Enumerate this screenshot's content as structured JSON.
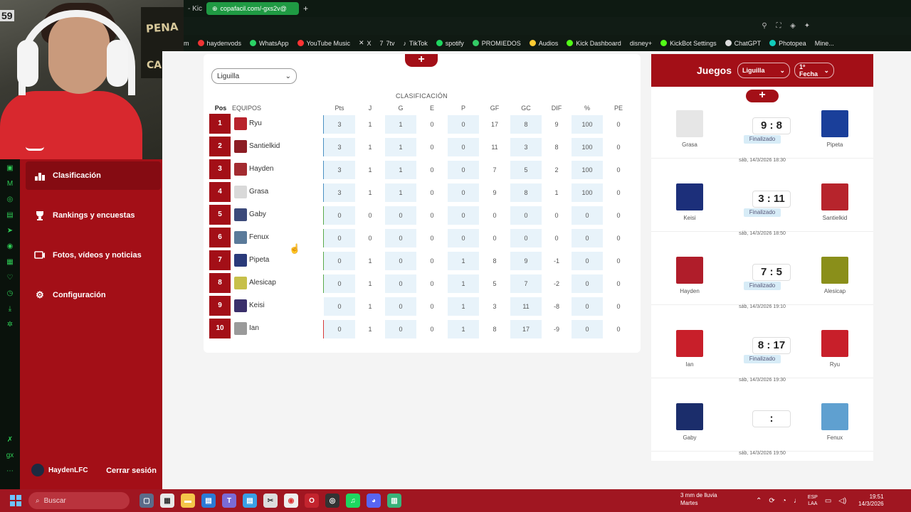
{
  "browser": {
    "prev_tab": "- Kic",
    "active_tab": "copafacil.com/-gxs2v@",
    "bookmarks": [
      "m",
      "haydenvods",
      "WhatsApp",
      "YouTube Music",
      "X",
      "7tv",
      "TikTok",
      "spotify",
      "PROMIEDOS",
      "Audios",
      "Kick Dashboard",
      "disney+",
      "KickBot Settings",
      "ChatGPT",
      "Photopea",
      "Mine..."
    ]
  },
  "webcam": {
    "wall_text_1": "PENA",
    "wall_text_2": "CAMPE",
    "number": "59"
  },
  "sidebar": {
    "items": [
      {
        "label": "Clasificación"
      },
      {
        "label": "Rankings y encuestas"
      },
      {
        "label": "Fotos, vídeos y noticias"
      },
      {
        "label": "Configuración"
      }
    ],
    "user": "HaydenLFC",
    "logout": "Cerrar sesión"
  },
  "standings": {
    "add_label": "+",
    "group_select": "Liguilla",
    "title": "CLASIFICACIÓN",
    "headers": {
      "pos": "Pos",
      "team": "EQUIPOS",
      "pts": "Pts",
      "j": "J",
      "g": "G",
      "e": "E",
      "p": "P",
      "gf": "GF",
      "gc": "GC",
      "dif": "DIF",
      "pct": "%",
      "pe": "PE"
    },
    "rows": [
      {
        "pos": "1",
        "team": "Ryu",
        "pts": "3",
        "j": "1",
        "g": "1",
        "e": "0",
        "p": "0",
        "gf": "17",
        "gc": "8",
        "dif": "9",
        "pct": "100",
        "pe": "0"
      },
      {
        "pos": "2",
        "team": "Santielkid",
        "pts": "3",
        "j": "1",
        "g": "1",
        "e": "0",
        "p": "0",
        "gf": "11",
        "gc": "3",
        "dif": "8",
        "pct": "100",
        "pe": "0"
      },
      {
        "pos": "3",
        "team": "Hayden",
        "pts": "3",
        "j": "1",
        "g": "1",
        "e": "0",
        "p": "0",
        "gf": "7",
        "gc": "5",
        "dif": "2",
        "pct": "100",
        "pe": "0"
      },
      {
        "pos": "4",
        "team": "Grasa",
        "pts": "3",
        "j": "1",
        "g": "1",
        "e": "0",
        "p": "0",
        "gf": "9",
        "gc": "8",
        "dif": "1",
        "pct": "100",
        "pe": "0"
      },
      {
        "pos": "5",
        "team": "Gaby",
        "pts": "0",
        "j": "0",
        "g": "0",
        "e": "0",
        "p": "0",
        "gf": "0",
        "gc": "0",
        "dif": "0",
        "pct": "0",
        "pe": "0"
      },
      {
        "pos": "6",
        "team": "Fenux",
        "pts": "0",
        "j": "0",
        "g": "0",
        "e": "0",
        "p": "0",
        "gf": "0",
        "gc": "0",
        "dif": "0",
        "pct": "0",
        "pe": "0"
      },
      {
        "pos": "7",
        "team": "Pipeta",
        "pts": "0",
        "j": "1",
        "g": "0",
        "e": "0",
        "p": "1",
        "gf": "8",
        "gc": "9",
        "dif": "-1",
        "pct": "0",
        "pe": "0"
      },
      {
        "pos": "8",
        "team": "Alesicap",
        "pts": "0",
        "j": "1",
        "g": "0",
        "e": "0",
        "p": "1",
        "gf": "5",
        "gc": "7",
        "dif": "-2",
        "pct": "0",
        "pe": "0"
      },
      {
        "pos": "9",
        "team": "Keisi",
        "pts": "0",
        "j": "1",
        "g": "0",
        "e": "0",
        "p": "1",
        "gf": "3",
        "gc": "11",
        "dif": "-8",
        "pct": "0",
        "pe": "0"
      },
      {
        "pos": "10",
        "team": "Ian",
        "pts": "0",
        "j": "1",
        "g": "0",
        "e": "0",
        "p": "1",
        "gf": "8",
        "gc": "17",
        "dif": "-9",
        "pct": "0",
        "pe": "0"
      }
    ],
    "zone_colors": [
      "#4a90c2",
      "#4a90c2",
      "#4a90c2",
      "#4a90c2",
      "#5aaa4a",
      "#5aaa4a",
      "#5aaa4a",
      "#5aaa4a",
      "none",
      "#d83a3a"
    ]
  },
  "games": {
    "title": "Juegos",
    "group_select": "Liguilla",
    "round_select": "1º Fecha",
    "add_label": "+",
    "matches": [
      {
        "home": "Grasa",
        "away": "Pipeta",
        "score": "9 : 8",
        "status": "Finalizado",
        "date": "sáb, 14/3/2026 18:30"
      },
      {
        "home": "Keisi",
        "away": "Santielkid",
        "score": "3 : 11",
        "status": "Finalizado",
        "date": "sáb, 14/3/2026 18:50"
      },
      {
        "home": "Hayden",
        "away": "Alesicap",
        "score": "7 : 5",
        "status": "Finalizado",
        "date": "sáb, 14/3/2026 19:10"
      },
      {
        "home": "Ian",
        "away": "Ryu",
        "score": "8 : 17",
        "status": "Finalizado",
        "date": "sáb, 14/3/2026 19:30"
      },
      {
        "home": "Gaby",
        "away": "Fenux",
        "score": ":",
        "status": "",
        "date": "sáb, 14/3/2026 19:50"
      }
    ]
  },
  "taskbar": {
    "search": "Buscar",
    "weather_1": "3 mm de lluvia",
    "weather_2": "Martes",
    "lang_1": "ESP",
    "lang_2": "LAA",
    "time": "19:51",
    "date": "14/3/2026"
  },
  "colors": {
    "brand": "#a30f17",
    "sidebar": "#a30f17",
    "taskbar": "#a01621",
    "active_tab": "#1f9a43"
  }
}
